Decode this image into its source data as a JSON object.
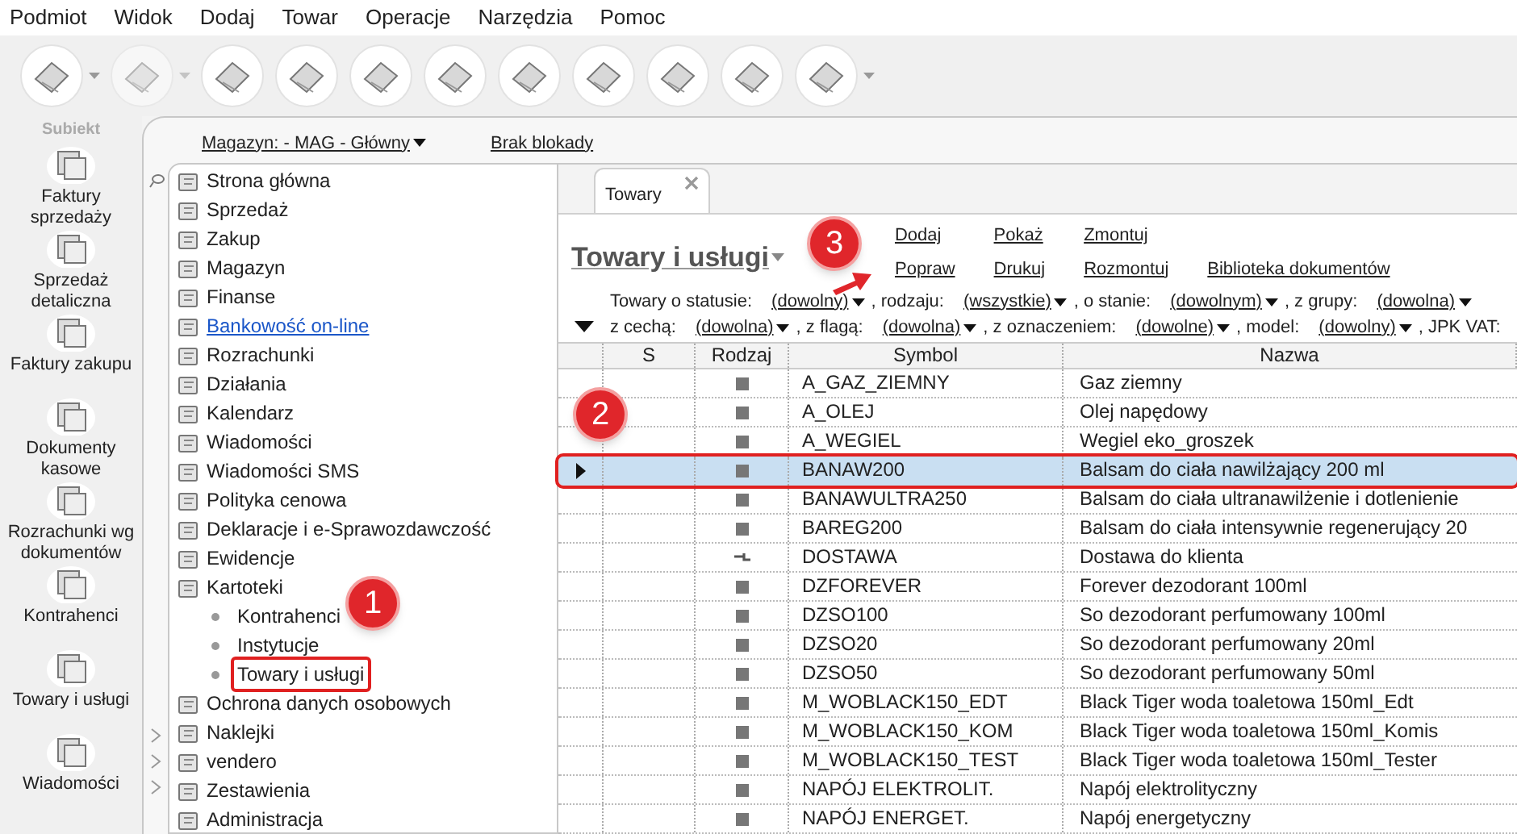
{
  "menu": [
    "Podmiot",
    "Widok",
    "Dodaj",
    "Towar",
    "Operacje",
    "Narzędzia",
    "Pomoc"
  ],
  "toolbar": [
    {
      "has_menu": true,
      "disabled": false
    },
    {
      "has_menu": true,
      "disabled": true
    },
    {
      "has_menu": false,
      "disabled": false
    },
    {
      "has_menu": false,
      "disabled": false
    },
    {
      "has_menu": false,
      "disabled": false
    },
    {
      "has_menu": false,
      "disabled": false
    },
    {
      "has_menu": false,
      "disabled": false
    },
    {
      "has_menu": false,
      "disabled": false
    },
    {
      "has_menu": false,
      "disabled": false
    },
    {
      "has_menu": false,
      "disabled": false
    },
    {
      "has_menu": true,
      "disabled": false
    }
  ],
  "logo": {
    "text": "Subiekt"
  },
  "warehouse": {
    "label": "Magazyn: - MAG - Główny",
    "lock": "Brak blokady"
  },
  "sidebar": {
    "items": [
      "Faktury sprzedaży",
      "Sprzedaż detaliczna",
      "Faktury zakupu",
      "Dokumenty kasowe",
      "Rozrachunki wg dokumentów",
      "Kontrahenci",
      "Towary i usługi",
      "Wiadomości"
    ]
  },
  "tree": [
    {
      "label": "Strona główna",
      "kind": "item"
    },
    {
      "label": "Sprzedaż",
      "kind": "item"
    },
    {
      "label": "Zakup",
      "kind": "item"
    },
    {
      "label": "Magazyn",
      "kind": "item"
    },
    {
      "label": "Finanse",
      "kind": "item"
    },
    {
      "label": "Bankowość on-line",
      "kind": "link"
    },
    {
      "label": "Rozrachunki",
      "kind": "item"
    },
    {
      "label": "Działania",
      "kind": "item"
    },
    {
      "label": "Kalendarz",
      "kind": "item"
    },
    {
      "label": "Wiadomości",
      "kind": "item"
    },
    {
      "label": "Wiadomości SMS",
      "kind": "item"
    },
    {
      "label": "Polityka cenowa",
      "kind": "item"
    },
    {
      "label": "Deklaracje i e-Sprawozdawczość",
      "kind": "item"
    },
    {
      "label": "Ewidencje",
      "kind": "item"
    },
    {
      "label": "Kartoteki",
      "kind": "item",
      "children": [
        {
          "label": "Kontrahenci",
          "highlighted": false
        },
        {
          "label": "Instytucje",
          "highlighted": false
        },
        {
          "label": "Towary i usługi",
          "highlighted": true
        }
      ]
    },
    {
      "label": "Ochrona danych osobowych",
      "kind": "item"
    },
    {
      "label": "Naklejki",
      "kind": "item"
    },
    {
      "label": "vendero",
      "kind": "item"
    },
    {
      "label": "Zestawienia",
      "kind": "item"
    },
    {
      "label": "Administracja",
      "kind": "item"
    }
  ],
  "tabs": [
    {
      "label": "Towary",
      "selected": true
    }
  ],
  "title": "Towary i usługi",
  "actions": [
    [
      "Dodaj",
      "Popraw"
    ],
    [
      "Pokaż",
      "Drukuj"
    ],
    [
      "Zmontuj",
      "Rozmontuj"
    ],
    [
      "Biblioteka dokumentów"
    ]
  ],
  "filters": [
    [
      {
        "label": "Towary o statusie:",
        "value": "(dowolny)"
      },
      {
        "label": ", rodzaju:",
        "value": "(wszystkie)"
      },
      {
        "label": ", o stanie:",
        "value": "(dowolnym)"
      },
      {
        "label": ", z grupy:",
        "value": "(dowolna)"
      }
    ],
    [
      {
        "label": "z cechą:",
        "value": "(dowolna)"
      },
      {
        "label": ", z flagą:",
        "value": "(dowolna)"
      },
      {
        "label": ", z oznaczeniem:",
        "value": "(dowolne)"
      },
      {
        "label": ", model:",
        "value": "(dowolny)"
      },
      {
        "label": ", JPK VAT:"
      }
    ]
  ],
  "table": {
    "columns": [
      "S",
      "Rodzaj",
      "Symbol",
      "Nazwa"
    ],
    "rows": [
      {
        "kind": "goods",
        "symbol": "A_GAZ_ZIEMNY",
        "name": "Gaz ziemny",
        "selected": false
      },
      {
        "kind": "goods",
        "symbol": "A_OLEJ",
        "name": "Olej napędowy",
        "selected": false
      },
      {
        "kind": "goods",
        "symbol": "A_WEGIEL",
        "name": "Wegiel eko_groszek",
        "selected": false
      },
      {
        "kind": "goods",
        "symbol": "BANAW200",
        "name": "Balsam do ciała nawilżający 200 ml",
        "selected": true
      },
      {
        "kind": "goods",
        "symbol": "BANAWULTRA250",
        "name": "Balsam do ciała ultranawilżenie i dotlenienie",
        "selected": false
      },
      {
        "kind": "goods",
        "symbol": "BAREG200",
        "name": "Balsam do ciała intensywnie regenerujący 20",
        "selected": false
      },
      {
        "kind": "service",
        "symbol": "DOSTAWA",
        "name": "Dostawa do klienta",
        "selected": false
      },
      {
        "kind": "goods",
        "symbol": "DZFOREVER",
        "name": "Forever dezodorant 100ml",
        "selected": false
      },
      {
        "kind": "goods",
        "symbol": "DZSO100",
        "name": "So dezodorant perfumowany 100ml",
        "selected": false
      },
      {
        "kind": "goods",
        "symbol": "DZSO20",
        "name": "So dezodorant perfumowany 20ml",
        "selected": false
      },
      {
        "kind": "goods",
        "symbol": "DZSO50",
        "name": "So dezodorant perfumowany 50ml",
        "selected": false
      },
      {
        "kind": "goods",
        "symbol": "M_WOBLACK150_EDT",
        "name": "Black Tiger woda toaletowa 150ml_Edt",
        "selected": false
      },
      {
        "kind": "goods",
        "symbol": "M_WOBLACK150_KOM",
        "name": "Black Tiger woda toaletowa 150ml_Komis",
        "selected": false
      },
      {
        "kind": "goods",
        "symbol": "M_WOBLACK150_TEST",
        "name": "Black Tiger woda toaletowa 150ml_Tester",
        "selected": false
      },
      {
        "kind": "goods",
        "symbol": "NAPÓJ ELEKTROLIT.",
        "name": "Napój elektrolityczny",
        "selected": false
      },
      {
        "kind": "goods",
        "symbol": "NAPÓJ ENERGET.",
        "name": "Napój energetyczny",
        "selected": false
      }
    ]
  },
  "callouts": [
    {
      "number": "1"
    },
    {
      "number": "2"
    },
    {
      "number": "3"
    }
  ]
}
